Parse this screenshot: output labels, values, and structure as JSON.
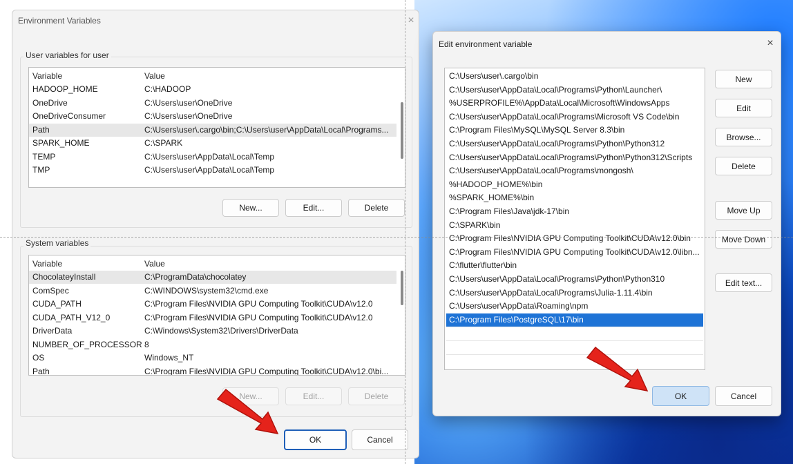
{
  "env_window": {
    "title": "Environment Variables",
    "user_group_label": "User variables for user",
    "system_group_label": "System variables",
    "columns": {
      "variable": "Variable",
      "value": "Value"
    },
    "user_vars": [
      {
        "name": "HADOOP_HOME",
        "value": "C:\\HADOOP"
      },
      {
        "name": "OneDrive",
        "value": "C:\\Users\\user\\OneDrive"
      },
      {
        "name": "OneDriveConsumer",
        "value": "C:\\Users\\user\\OneDrive"
      },
      {
        "name": "Path",
        "value": "C:\\Users\\user\\.cargo\\bin;C:\\Users\\user\\AppData\\Local\\Programs..."
      },
      {
        "name": "SPARK_HOME",
        "value": "C:\\SPARK"
      },
      {
        "name": "TEMP",
        "value": "C:\\Users\\user\\AppData\\Local\\Temp"
      },
      {
        "name": "TMP",
        "value": "C:\\Users\\user\\AppData\\Local\\Temp"
      }
    ],
    "system_vars": [
      {
        "name": "ChocolateyInstall",
        "value": "C:\\ProgramData\\chocolatey"
      },
      {
        "name": "ComSpec",
        "value": "C:\\WINDOWS\\system32\\cmd.exe"
      },
      {
        "name": "CUDA_PATH",
        "value": "C:\\Program Files\\NVIDIA GPU Computing Toolkit\\CUDA\\v12.0"
      },
      {
        "name": "CUDA_PATH_V12_0",
        "value": "C:\\Program Files\\NVIDIA GPU Computing Toolkit\\CUDA\\v12.0"
      },
      {
        "name": "DriverData",
        "value": "C:\\Windows\\System32\\Drivers\\DriverData"
      },
      {
        "name": "NUMBER_OF_PROCESSORS",
        "value": "8"
      },
      {
        "name": "OS",
        "value": "Windows_NT"
      },
      {
        "name": "Path",
        "value": "C:\\Program Files\\NVIDIA GPU Computing Toolkit\\CUDA\\v12.0\\bi..."
      }
    ],
    "user_buttons": {
      "new": "New...",
      "edit": "Edit...",
      "delete": "Delete"
    },
    "system_buttons": {
      "new": "New...",
      "edit": "Edit...",
      "delete": "Delete"
    },
    "ok": "OK",
    "cancel": "Cancel"
  },
  "edit_window": {
    "title": "Edit environment variable",
    "paths": [
      "C:\\Users\\user\\.cargo\\bin",
      "C:\\Users\\user\\AppData\\Local\\Programs\\Python\\Launcher\\",
      "%USERPROFILE%\\AppData\\Local\\Microsoft\\WindowsApps",
      "C:\\Users\\user\\AppData\\Local\\Programs\\Microsoft VS Code\\bin",
      "C:\\Program Files\\MySQL\\MySQL Server 8.3\\bin",
      "C:\\Users\\user\\AppData\\Local\\Programs\\Python\\Python312",
      "C:\\Users\\user\\AppData\\Local\\Programs\\Python\\Python312\\Scripts",
      "C:\\Users\\user\\AppData\\Local\\Programs\\mongosh\\",
      "%HADOOP_HOME%\\bin",
      "%SPARK_HOME%\\bin",
      "C:\\Program Files\\Java\\jdk-17\\bin",
      "C:\\SPARK\\bin",
      "C:\\Program Files\\NVIDIA GPU Computing Toolkit\\CUDA\\v12.0\\bin",
      "C:\\Program Files\\NVIDIA GPU Computing Toolkit\\CUDA\\v12.0\\libn...",
      "C:\\flutter\\flutter\\bin",
      "C:\\Users\\user\\AppData\\Local\\Programs\\Python\\Python310",
      "C:\\Users\\user\\AppData\\Local\\Programs\\Julia-1.11.4\\bin",
      "C:\\Users\\user\\AppData\\Roaming\\npm",
      "C:\\Program Files\\PostgreSQL\\17\\bin"
    ],
    "selected_index": 18,
    "buttons": {
      "new": "New",
      "edit": "Edit",
      "browse": "Browse...",
      "delete": "Delete",
      "move_up": "Move Up",
      "move_down": "Move Down",
      "edit_text": "Edit text..."
    },
    "ok": "OK",
    "cancel": "Cancel"
  },
  "icons": {
    "close": "×"
  },
  "colors": {
    "selection": "#1e73d6",
    "arrow": "#e5231b",
    "ok_border": "#1f5fb8"
  }
}
